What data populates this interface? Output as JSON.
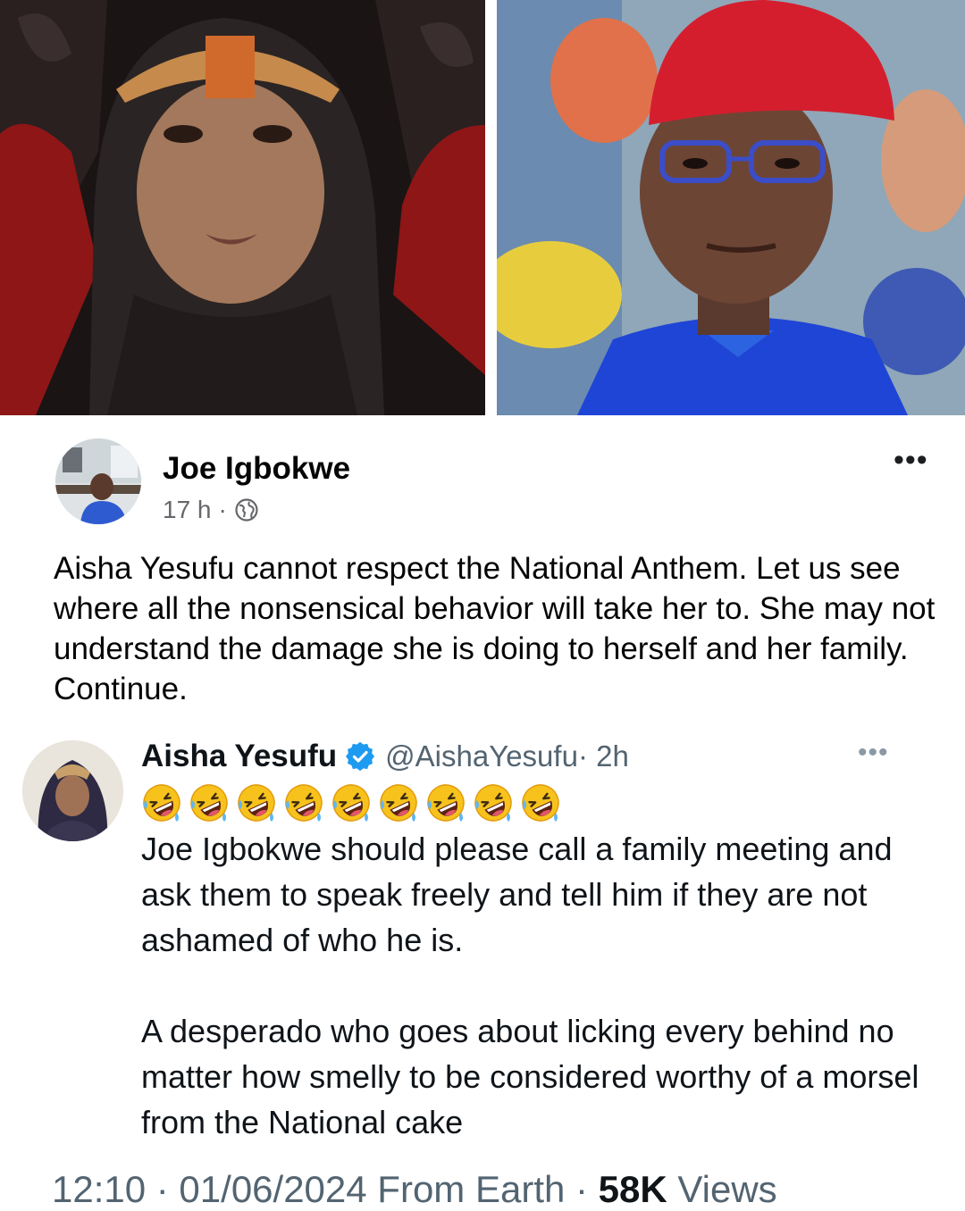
{
  "photos": {
    "left_alt": "Aisha Yesufu portrait",
    "right_alt": "Joe Igbokwe portrait"
  },
  "facebook_post": {
    "author": "Joe Igbokwe",
    "time": "17 h",
    "separator": "·",
    "privacy_icon": "globe-icon",
    "more_label": "•••",
    "text": "Aisha Yesufu cannot respect the National Anthem. Let us see where all the nonsensical behavior will take her to. She may not understand the damage she is doing to herself and her family. Continue."
  },
  "tweet": {
    "name": "Aisha Yesufu",
    "verified_icon": "verified-badge-icon",
    "handle": "@AishaYesufu",
    "time": "· 2h",
    "more_label": "•••",
    "emoji": [
      "🤣",
      "🤣",
      "🤣",
      "🤣",
      "🤣",
      "🤣",
      "🤣",
      "🤣",
      "🤣"
    ],
    "paragraph1": "Joe Igbokwe should please call a family meeting and ask them to speak freely and tell him if they are not ashamed of who he is.",
    "paragraph2": "A desperado who goes about licking every behind no matter how smelly to be considered worthy of a morsel from the National cake",
    "footer_time": "12:10 · 01/06/2024 From Earth · ",
    "footer_views_count": "58K",
    "footer_views_label": " Views"
  },
  "colors": {
    "fb_text": "#050505",
    "fb_meta": "#65676b",
    "tw_text": "#0f1419",
    "tw_secondary": "#536471",
    "verified": "#1d9bf0"
  }
}
